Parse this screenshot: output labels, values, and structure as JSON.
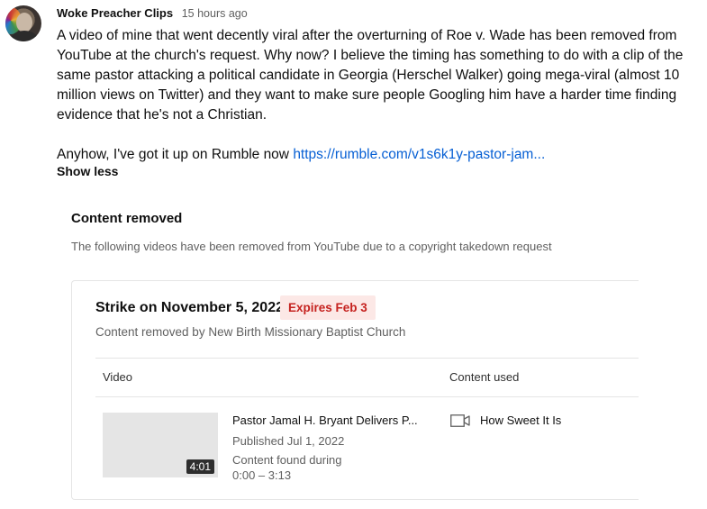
{
  "comment": {
    "author": "Woke Preacher Clips",
    "time": "15 hours ago",
    "paragraph1": "A video of mine that went decently viral after the overturning of Roe v. Wade has been removed from YouTube at the church's request. Why now? I believe the timing has something to do with a clip of the same pastor attacking a political candidate in Georgia (Herschel Walker) going mega-viral (almost 10 million views on Twitter) and they want to make sure people Googling him have a harder time finding evidence that he's not a Christian.",
    "paragraph2_prefix": "Anyhow, I've got it up on Rumble now ",
    "link_text": "https://rumble.com/v1s6k1y-pastor-jam...",
    "show_less": "Show less"
  },
  "notice": {
    "title": "Content removed",
    "description": "The following videos have been removed from YouTube due to a copyright takedown request",
    "strike": {
      "title": "Strike on November 5, 2022",
      "badge": "Expires Feb 3",
      "removed_by": "Content removed by New Birth Missionary Baptist Church"
    },
    "columns": {
      "video": "Video",
      "content_used": "Content used"
    },
    "video": {
      "duration": "4:01",
      "title": "Pastor Jamal H. Bryant Delivers P...",
      "published": "Published Jul 1, 2022",
      "found_label": "Content found during",
      "found_range": "0:00 – 3:13"
    },
    "content_used": {
      "icon": "video-camera-icon",
      "title": "How Sweet It Is"
    }
  },
  "colors": {
    "link": "#065fd4",
    "badge_bg": "#fce8e6",
    "badge_text": "#c5221f",
    "secondary_text": "#606060"
  }
}
